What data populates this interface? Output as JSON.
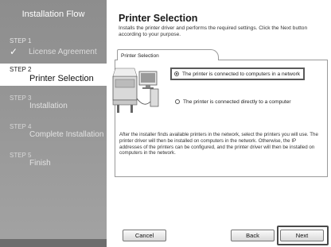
{
  "sidebar": {
    "title": "Installation Flow",
    "steps": [
      {
        "num": "STEP 1",
        "label": "License Agreement",
        "state": "done"
      },
      {
        "num": "STEP 2",
        "label": "Printer Selection",
        "state": "active"
      },
      {
        "num": "STEP 3",
        "label": "Installation",
        "state": "pending"
      },
      {
        "num": "STEP 4",
        "label": "Complete Installation",
        "state": "pending"
      },
      {
        "num": "STEP 5",
        "label": "Finish",
        "state": "pending"
      }
    ]
  },
  "main": {
    "title": "Printer Selection",
    "description": "Installs the printer driver and performs the required settings. Click the Next button according to your purpose.",
    "tab_label": "Printer Selection",
    "options": [
      {
        "label": "The printer is connected to computers in a network",
        "selected": true
      },
      {
        "label": "The printer is connected directly to a computer",
        "selected": false
      }
    ],
    "info_text": "After the installer finds available printers in the network, select the printers you will use. The printer driver will then be installed on computers in the network. Otherwise, the IP addresses of the printers can be configured, and the printer driver will then be installed on computers in the network."
  },
  "buttons": {
    "cancel": "Cancel",
    "back": "Back",
    "next": "Next"
  },
  "colors": {
    "sidebar_bg": "#9a9a9a",
    "highlight_border": "#4a4a4a"
  }
}
